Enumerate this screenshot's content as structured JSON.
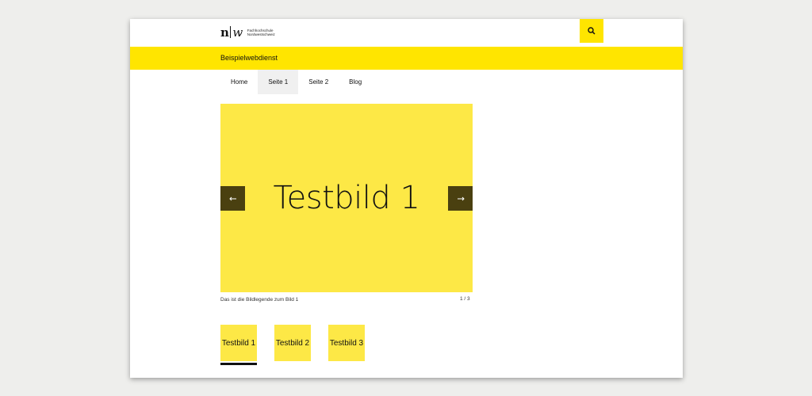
{
  "header": {
    "logo_mark_n": "n",
    "logo_mark_w": "w",
    "logo_line1": "Fachhochschule",
    "logo_line2": "Nordwestschweiz",
    "search_icon": "search-icon"
  },
  "site": {
    "title": "Beispielwebdienst"
  },
  "nav": {
    "items": [
      {
        "label": "Home"
      },
      {
        "label": "Seite 1"
      },
      {
        "label": "Seite 2"
      },
      {
        "label": "Blog"
      }
    ]
  },
  "slider": {
    "slide_text": "Testbild 1",
    "caption": "Das ist die Bildlegende zum Bild 1",
    "counter": "1 / 3",
    "prev_icon": "arrow-left-icon",
    "next_icon": "arrow-right-icon"
  },
  "thumbnails": [
    {
      "label": "Testbild 1"
    },
    {
      "label": "Testbild 2"
    },
    {
      "label": "Testbild 3"
    }
  ],
  "colors": {
    "accent": "#ffe500",
    "slide_bg": "#fde846",
    "arrow_bg": "#4a4010"
  }
}
